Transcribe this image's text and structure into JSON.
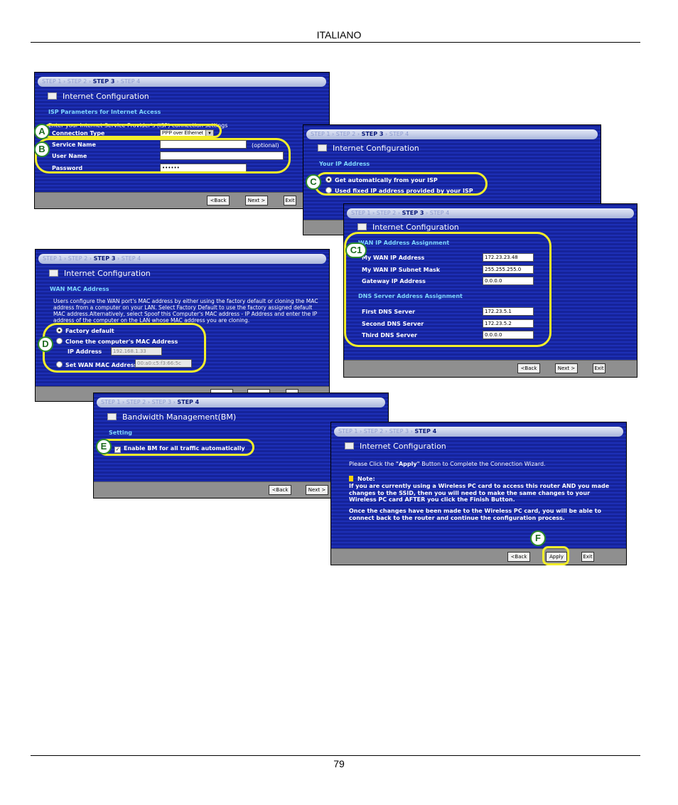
{
  "header": {
    "language": "ITALIANO",
    "page_number": "79"
  },
  "steps": {
    "step1": "STEP 1",
    "step2": "STEP 2",
    "step3": "STEP 3",
    "step4": "STEP 4",
    "sep": "›"
  },
  "buttons": {
    "back": "<Back",
    "next": "Next >",
    "exit": "Exit",
    "apply": "Apply"
  },
  "win_a": {
    "title": "Internet Configuration",
    "section": "ISP Parameters for Internet Access",
    "intro": "Enter your Internet Service Provider's (ISP) connection settings",
    "connection_type_label": "Connection Type",
    "connection_type_value": "PPP over Ethernet",
    "service_name_label": "Service Name",
    "service_name_hint": "(optional)",
    "user_name_label": "User Name",
    "password_label": "Password",
    "password_value": "••••••"
  },
  "win_c": {
    "title": "Internet Configuration",
    "section": "Your IP Address",
    "opt_auto": "Get automatically from your ISP",
    "opt_fixed": "Used fixed IP address provided by your ISP"
  },
  "win_c1": {
    "title": "Internet Configuration",
    "section_wan": "WAN IP Address Assignment",
    "my_wan_ip_label": "My WAN IP Address",
    "my_wan_ip_value": "172.23.23.48",
    "subnet_label": "My WAN IP Subnet Mask",
    "subnet_value": "255.255.255.0",
    "gateway_label": "Gateway IP Address",
    "gateway_value": "0.0.0.0",
    "section_dns": "DNS Server Address Assignment",
    "dns1_label": "First DNS Server",
    "dns1_value": "172.23.5.1",
    "dns2_label": "Second DNS Server",
    "dns2_value": "172.23.5.2",
    "dns3_label": "Third DNS Server",
    "dns3_value": "0.0.0.0"
  },
  "win_d": {
    "title": "Internet Configuration",
    "section": "WAN MAC Address",
    "paragraph": "Users configure the WAN port's MAC address by either using the factory default or cloning the MAC address from a computer on your LAN. Select Factory Default to use the factory assigned default MAC address.Alternatively, select Spoof this Computer's MAC address - IP Address and enter the IP address of the computer on the LAN whose MAC address you are cloning.",
    "opt_factory": "Factory default",
    "opt_clone": "Clone the computer's MAC Address",
    "ip_label": "IP Address",
    "ip_value": "192.168.1.33",
    "opt_set": "Set WAN MAC Address",
    "mac_value": "00:a0:c5:f3:66:5c"
  },
  "win_e": {
    "title": "Bandwidth Management(BM)",
    "section": "Setting",
    "checkbox_label": "Enable BM for all traffic automatically"
  },
  "win_f": {
    "title": "Internet Configuration",
    "instruction_pre": "Please Click the ",
    "instruction_bold": "\"Apply\"",
    "instruction_post": " Button to Complete the Connection Wizard.",
    "note_label": "Note:",
    "note_text": "If you are currently using a Wireless PC card to access this router AND you made changes to the SSID, then you will need to make the same changes to your Wireless PC card AFTER you click the Finish Button.",
    "after_text": "Once the changes have been made to the Wireless PC card, you will be able to connect back to the router and continue the configuration process."
  },
  "callouts": {
    "a": "A",
    "b": "B",
    "c": "C",
    "c1": "C1",
    "d": "D",
    "e": "E",
    "f": "F"
  },
  "colors": {
    "panel": "#15239a",
    "highlight": "#f3ee2a",
    "badge_green": "#2b8a2b",
    "section_text": "#7fd7ff"
  }
}
